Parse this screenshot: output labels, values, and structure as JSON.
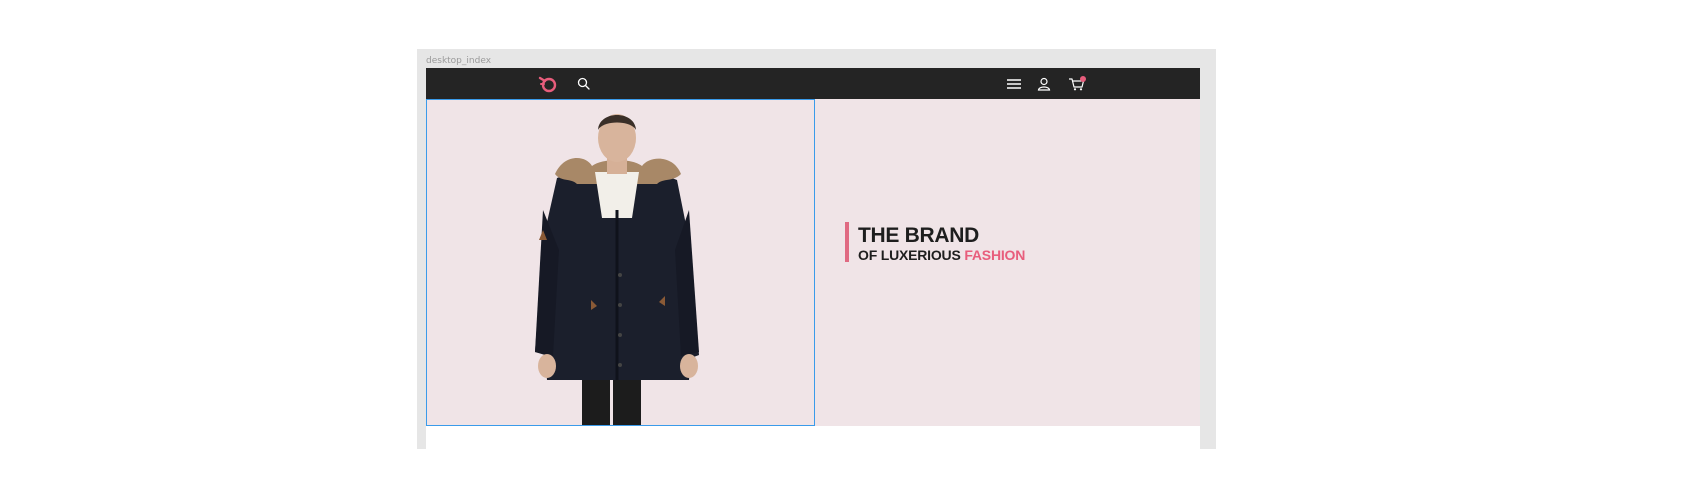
{
  "artboard": {
    "label": "desktop_index"
  },
  "nav": {
    "logo_icon": "brand-logo-icon",
    "search_icon": "search-icon",
    "menu_icon": "hamburger-menu-icon",
    "user_icon": "user-icon",
    "cart_icon": "cart-icon"
  },
  "hero": {
    "title": "THE BRAND",
    "subtitle_prefix": "OF LUXERIOUS",
    "subtitle_highlight": "FASHION",
    "product_image": "man-in-navy-parka-with-fur-hood"
  },
  "colors": {
    "navbar": "#242424",
    "hero_bg": "#f0e4e7",
    "accent": "#e85d7c",
    "text": "#1e1e1e",
    "selection": "#3a9bea"
  }
}
